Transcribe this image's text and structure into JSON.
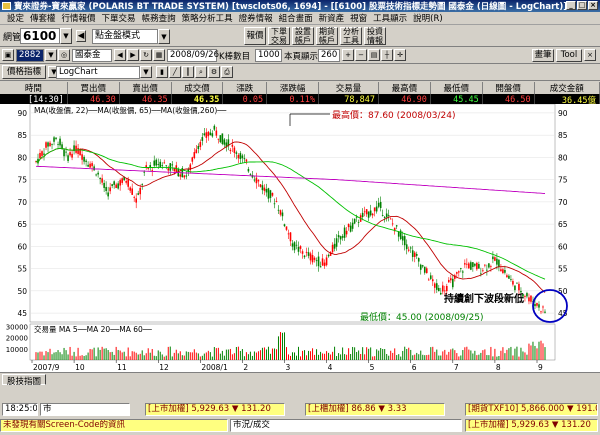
{
  "window": {
    "title": "寶來證券-寶來贏家 (POLARIS BT TRADE SYSTEM)  [twsclots06, 1694]  - [[6100] 股票技術指標走勢圖  國泰金 (日線圖 - LogChart)]"
  },
  "menu": [
    "設定",
    "傳套權",
    "行情報價",
    "下單交易",
    "帳務查詢",
    "策略分析工具",
    "證券情報",
    "組合畫面",
    "新資產",
    "視窗",
    "工具顯示",
    "說明(R)"
  ],
  "toolbar1": {
    "label": "網管",
    "code": "6100",
    "mode": "點金盤模式",
    "buttons": [
      "報價",
      "下單交易",
      "設置帳戶",
      "期貨帳戶",
      "分析工具",
      "投資情報"
    ]
  },
  "toolbar2": {
    "symbol": "2882",
    "name": "國泰金",
    "date": "2008/09/26",
    "count_label": "K棒數目",
    "count": "1000",
    "show_label": "本頁顯示",
    "show": "260",
    "right_buttons": [
      "畫筆",
      "Tool"
    ]
  },
  "toolbar3": {
    "indicator_btn": "價格指標",
    "chart_type": "LogChart"
  },
  "quote": {
    "headers": [
      "時間",
      "買出價",
      "賣出價",
      "成交價",
      "漲跌",
      "漲跌幅",
      "交易量",
      "最高價",
      "最低價",
      "開盤價",
      "成交金額"
    ],
    "values": [
      "[14:30]",
      "46.30",
      "46.35",
      "46.35",
      "0.05",
      "0.11%",
      "78,847",
      "46.90",
      "45.45",
      "46.50",
      "36.45億"
    ]
  },
  "chart": {
    "legend": "MA(收盤價, 22)──MA(收盤價, 65)──MA(收盤價,260)──",
    "high_label": "最高價：87.60 (2008/03/24)",
    "low_label": "最低價：45.00 (2008/09/25)",
    "annotation": "持續創下波段新低",
    "volume_legend": "交易量 MA 5──MA 20──MA 60──",
    "y_ticks": [
      "90",
      "85",
      "80",
      "75",
      "70",
      "65",
      "60",
      "55",
      "50",
      "45"
    ],
    "vol_ticks": [
      "30000",
      "20000",
      "10000"
    ],
    "x_labels": [
      "2007/9",
      "10",
      "11",
      "12",
      "2008/1",
      "2",
      "3",
      "4",
      "5",
      "6",
      "7",
      "8",
      "9"
    ],
    "colors": {
      "up": "#ff0000",
      "down": "#008000",
      "ma22": "#c00000",
      "ma65": "#00c000",
      "ma260": "#c000c0",
      "circle": "#0000c0"
    }
  },
  "tabs": [
    "股技指圖"
  ],
  "status": {
    "time": "18:25:05",
    "market": "市",
    "items": [
      "[上市加權]  5,929.63 ▼ 131.20",
      "[上櫃加權]  86.86 ▼ 3.33",
      "[期貨TXF10]  5,866.000 ▼ 191.000"
    ],
    "message": "未發現有關Screen-Code的資訊",
    "field2": "市況/成交",
    "last": "[上市加權]  5,929.63 ▼ 131.20"
  }
}
